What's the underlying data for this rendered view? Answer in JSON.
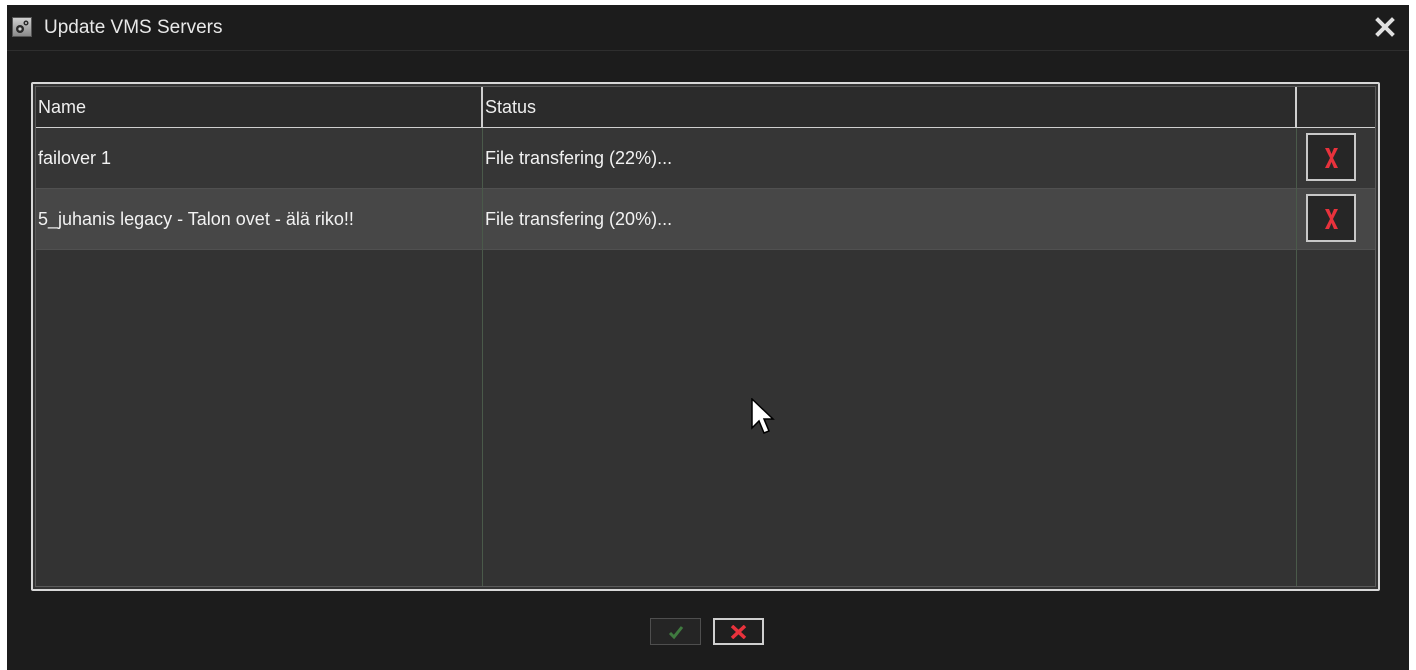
{
  "window": {
    "title": "Update VMS Servers"
  },
  "table": {
    "columns": [
      "Name",
      "Status",
      ""
    ],
    "rows": [
      {
        "name": "failover 1",
        "status": "File transfering (22%)..."
      },
      {
        "name": "5_juhanis legacy - Talon ovet - älä riko!!",
        "status": "File transfering (20%)..."
      }
    ]
  },
  "colors": {
    "background": "#1c1c1c",
    "table_bg": "#333333",
    "selected_row": "#474747",
    "delete_red": "#e8323c",
    "ok_green": "#3f7a3f"
  },
  "icons": {
    "app": "gear-icon",
    "close": "close-icon",
    "row_delete": "red-x-icon",
    "ok": "checkmark-icon",
    "cancel": "red-x-icon",
    "pointer": "mouse-cursor-icon"
  }
}
